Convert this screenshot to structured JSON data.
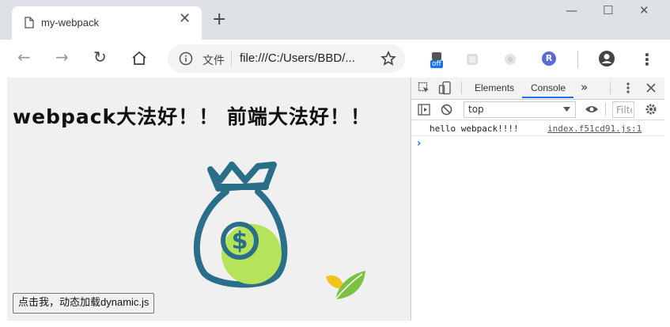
{
  "tab": {
    "title": "my-webpack",
    "close": "✕",
    "new_tab": "+"
  },
  "window_controls": {
    "minimize": "—",
    "maximize": "☐",
    "close": "✕"
  },
  "toolbar": {
    "back": "←",
    "forward": "→",
    "reload": "↻",
    "home": "⌂",
    "url_label": "文件",
    "url": "file:///C:/Users/BBD/...",
    "extension_badge": "off",
    "extension_r": "R",
    "menu": "⋮"
  },
  "page": {
    "heading": "webpack大法好！！ 前端大法好！！",
    "button_label": "点击我，动态加载dynamic.js"
  },
  "devtools": {
    "tabs": [
      "Elements",
      "Console"
    ],
    "more_tabs": "»",
    "context": "top",
    "filter_placeholder": "Filter",
    "log": {
      "message": "hello webpack!!!!",
      "source": "index.f51cd91.js:1"
    },
    "prompt": "›"
  },
  "colors": {
    "bag": "#2a6f8a",
    "coin": "#b5e35a",
    "leaf_green": "#7cc242",
    "leaf_yellow": "#f2c31b",
    "accent": "#1a73e8"
  }
}
